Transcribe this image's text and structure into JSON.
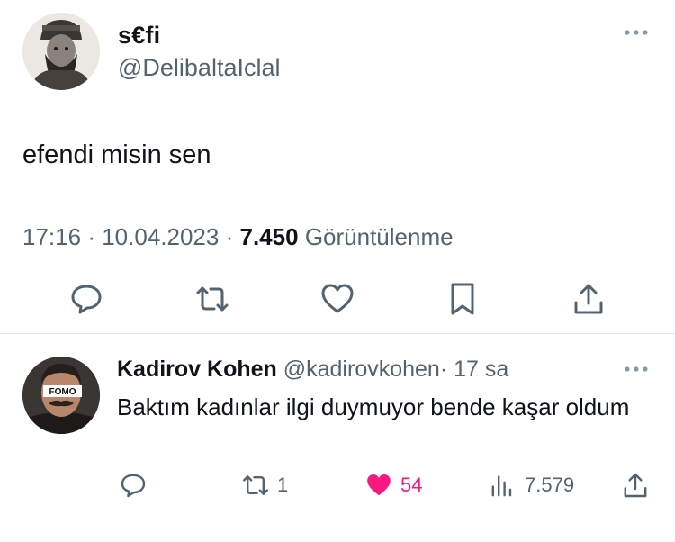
{
  "main_tweet": {
    "author_name": "s€fi",
    "author_handle": "@DelibaltaIclal",
    "text": "efendi misin sen",
    "time": "17:16",
    "date": "10.04.2023",
    "view_count": "7.450",
    "view_label": "Görüntülenme",
    "separator": "·"
  },
  "reply": {
    "author_name": "Kadirov Kohen",
    "author_handle": "@kadirovkohen",
    "separator": "·",
    "relative_time": "17 sa",
    "text": "Baktım kadınlar ilgi duymuyor bende kaşar oldum",
    "avatar_label": "FOMO",
    "retweet_count": "1",
    "like_count": "54",
    "view_count": "7.579"
  },
  "icons": {
    "reply": "reply-icon",
    "retweet": "retweet-icon",
    "like": "heart-icon",
    "bookmark": "bookmark-icon",
    "share": "share-icon",
    "views": "views-icon",
    "more": "more-icon"
  },
  "colors": {
    "text": "#0f1419",
    "secondary": "#536471",
    "like": "#f91880",
    "divider": "#dfe3e6"
  }
}
